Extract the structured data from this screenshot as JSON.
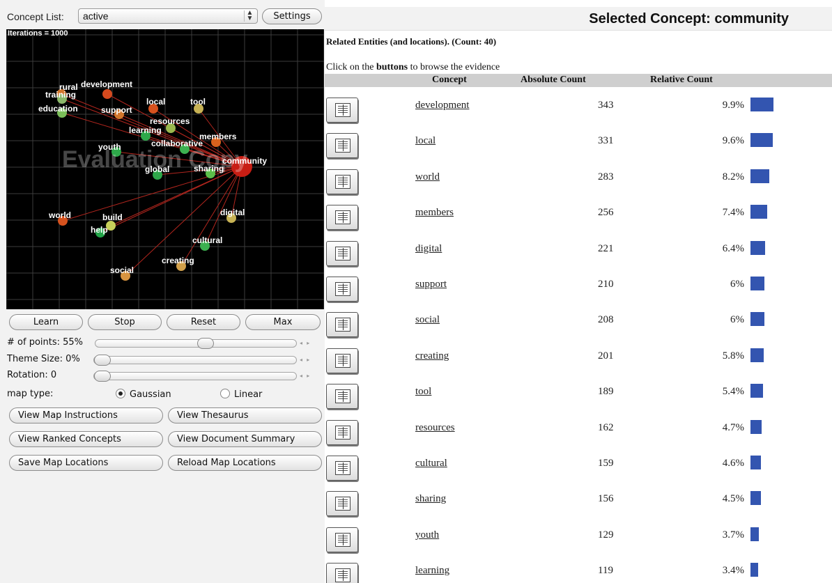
{
  "concept_list": {
    "label": "Concept List:",
    "value": "active",
    "arrows": "▲▼"
  },
  "settings_label": "Settings",
  "map": {
    "iterations_text": "Iterations = 1000",
    "watermark": "Evaluation Copy",
    "center": {
      "label": "community",
      "color": "#c81e14"
    },
    "nodes": [
      {
        "label": "rural",
        "color": "#d2762c"
      },
      {
        "label": "training",
        "color": "#8cb86a"
      },
      {
        "label": "development",
        "color": "#d64a1e"
      },
      {
        "label": "education",
        "color": "#7cbf5a"
      },
      {
        "label": "support",
        "color": "#d2762c"
      },
      {
        "label": "local",
        "color": "#d8521e"
      },
      {
        "label": "tool",
        "color": "#c7b254"
      },
      {
        "label": "resources",
        "color": "#9ab84e"
      },
      {
        "label": "learning",
        "color": "#2ea84a"
      },
      {
        "label": "members",
        "color": "#d8621e"
      },
      {
        "label": "collaborative",
        "color": "#3cb050"
      },
      {
        "label": "youth",
        "color": "#2ea84a"
      },
      {
        "label": "global",
        "color": "#2ea84a"
      },
      {
        "label": "sharing",
        "color": "#5cbf4a"
      },
      {
        "label": "world",
        "color": "#d6521e"
      },
      {
        "label": "build",
        "color": "#c7d05a"
      },
      {
        "label": "help",
        "color": "#22a448"
      },
      {
        "label": "digital",
        "color": "#c7b254"
      },
      {
        "label": "cultural",
        "color": "#3cb050"
      },
      {
        "label": "creating",
        "color": "#d2a04a"
      },
      {
        "label": "social",
        "color": "#d89440"
      }
    ]
  },
  "controls": {
    "learn": "Learn",
    "stop": "Stop",
    "reset": "Reset",
    "max": "Max",
    "points_label": "# of points: 55%",
    "points_value": 0.55,
    "theme_label": "Theme Size: 0%",
    "theme_value": 0.0,
    "rotation_label": "Rotation: 0",
    "rotation_value": 0.0,
    "maptype_label": "map type:",
    "gaussian": "Gaussian",
    "linear": "Linear",
    "selected_map_type": "Gaussian",
    "view_map_instructions": "View Map Instructions",
    "view_thesaurus": "View Thesaurus",
    "view_ranked_concepts": "View Ranked Concepts",
    "view_document_summary": "View Document Summary",
    "save_map_locations": "Save Map Locations",
    "reload_map_locations": "Reload Map Locations"
  },
  "right": {
    "title": "Selected Concept: community",
    "related": "Related Entities (and locations). (Count: 40)",
    "click_prefix": "Click on the ",
    "click_bold": "buttons",
    "click_suffix": " to browse the evidence",
    "headers": {
      "concept": "Concept",
      "absolute": "Absolute Count",
      "relative": "Relative Count"
    },
    "bar_color": "#3355b0",
    "rows": [
      {
        "concept": "development",
        "absolute": "343",
        "relative": "9.9%",
        "pct": 9.9
      },
      {
        "concept": "local",
        "absolute": "331",
        "relative": "9.6%",
        "pct": 9.6
      },
      {
        "concept": "world",
        "absolute": "283",
        "relative": "8.2%",
        "pct": 8.2
      },
      {
        "concept": "members",
        "absolute": "256",
        "relative": "7.4%",
        "pct": 7.4
      },
      {
        "concept": "digital",
        "absolute": "221",
        "relative": "6.4%",
        "pct": 6.4
      },
      {
        "concept": "support",
        "absolute": "210",
        "relative": "6%",
        "pct": 6.0
      },
      {
        "concept": "social",
        "absolute": "208",
        "relative": "6%",
        "pct": 6.0
      },
      {
        "concept": "creating",
        "absolute": "201",
        "relative": "5.8%",
        "pct": 5.8
      },
      {
        "concept": "tool",
        "absolute": "189",
        "relative": "5.4%",
        "pct": 5.4
      },
      {
        "concept": "resources",
        "absolute": "162",
        "relative": "4.7%",
        "pct": 4.7
      },
      {
        "concept": "cultural",
        "absolute": "159",
        "relative": "4.6%",
        "pct": 4.6
      },
      {
        "concept": "sharing",
        "absolute": "156",
        "relative": "4.5%",
        "pct": 4.5
      },
      {
        "concept": "youth",
        "absolute": "129",
        "relative": "3.7%",
        "pct": 3.7
      },
      {
        "concept": "learning",
        "absolute": "119",
        "relative": "3.4%",
        "pct": 3.4
      }
    ]
  }
}
